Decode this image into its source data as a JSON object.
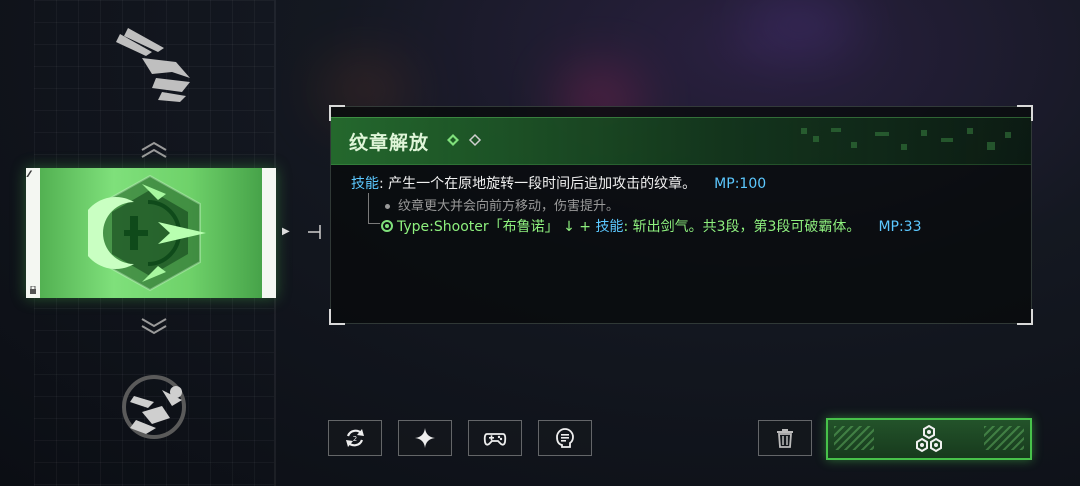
{
  "panel": {
    "title": "纹章解放",
    "line1": {
      "label": "技能",
      "sep": ": ",
      "text": "产生一个在原地旋转一段时间后追加攻击的纹章。",
      "mp": "MP:100"
    },
    "line2": {
      "text": "纹章更大并会向前方移动，伤害提升。"
    },
    "line3": {
      "prefix": "Type:Shooter「布鲁诺」 ↓ + ",
      "label": "技能",
      "sep": ": ",
      "text": "斩出剑气。共3段，第3段可破霸体。",
      "mp": "MP:33"
    }
  },
  "selected_card": {
    "corner_marks": "⁄⁄⁄"
  },
  "toolbar": {
    "buttons": [
      {
        "icon": "swap-icon"
      },
      {
        "icon": "sparkle-icon"
      },
      {
        "icon": "gamepad-icon"
      },
      {
        "icon": "chat-head-icon"
      },
      {
        "icon": "trash-icon"
      }
    ],
    "primary_icon": "hex-cluster-icon"
  },
  "colors": {
    "accent_green": "#7fe07b",
    "mp_blue": "#5cc8ff",
    "panel_header": "#2a7a36"
  }
}
